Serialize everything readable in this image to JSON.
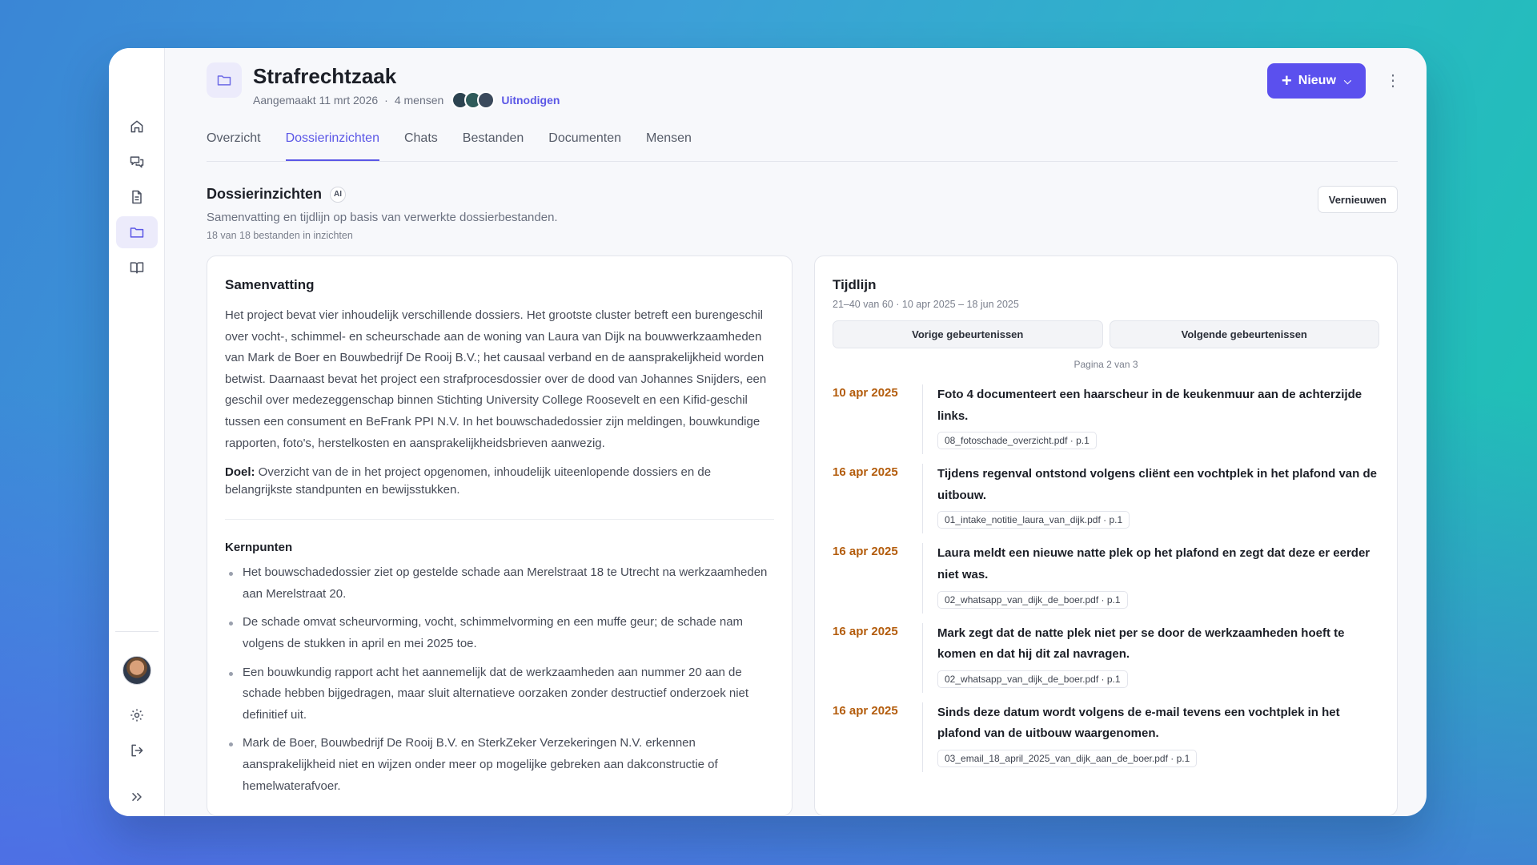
{
  "project": {
    "title": "Strafrechtzaak",
    "created": "Aangemaakt 11 mrt 2026",
    "separator": "·",
    "people_count": "4 mensen",
    "invite_label": "Uitnodigen"
  },
  "header": {
    "new_button": "Nieuw"
  },
  "tabs": [
    {
      "label": "Overzicht"
    },
    {
      "label": "Dossierinzichten"
    },
    {
      "label": "Chats"
    },
    {
      "label": "Bestanden"
    },
    {
      "label": "Documenten"
    },
    {
      "label": "Mensen"
    }
  ],
  "section": {
    "title": "Dossierinzichten",
    "ai_badge": "AI",
    "subtitle": "Samenvatting en tijdlijn op basis van verwerkte dossierbestanden.",
    "note": "18 van 18 bestanden in inzichten",
    "refresh_button": "Vernieuwen"
  },
  "summary": {
    "title": "Samenvatting",
    "text": "Het project bevat vier inhoudelijk verschillende dossiers. Het grootste cluster betreft een burengeschil over vocht-, schimmel- en scheurschade aan de woning van Laura van Dijk na bouwwerkzaamheden van Mark de Boer en Bouwbedrijf De Rooij B.V.; het causaal verband en de aansprakelijkheid worden betwist. Daarnaast bevat het project een strafprocesdossier over de dood van Johannes Snijders, een geschil over medezeggenschap binnen Stichting University College Roosevelt en een Kifid-geschil tussen een consument en BeFrank PPI N.V. In het bouwschadedossier zijn meldingen, bouwkundige rapporten, foto's, herstelkosten en aansprakelijkheidsbrieven aanwezig.",
    "goal_label": "Doel:",
    "goal_text": " Overzicht van de in het project opgenomen, inhoudelijk uiteenlopende dossiers en de belangrijkste standpunten en bewijsstukken.",
    "key_points_title": "Kernpunten",
    "key_points": [
      "Het bouwschadedossier ziet op gestelde schade aan Merelstraat 18 te Utrecht na werkzaamheden aan Merelstraat 20.",
      "De schade omvat scheurvorming, vocht, schimmelvorming en een muffe geur; de schade nam volgens de stukken in april en mei 2025 toe.",
      "Een bouwkundig rapport acht het aannemelijk dat de werkzaamheden aan nummer 20 aan de schade hebben bijgedragen, maar sluit alternatieve oorzaken zonder destructief onderzoek niet definitief uit.",
      "Mark de Boer, Bouwbedrijf De Rooij B.V. en SterkZeker Verzekeringen N.V. erkennen aansprakelijkheid niet en wijzen onder meer op mogelijke gebreken aan dakconstructie of hemelwaterafvoer."
    ]
  },
  "timeline": {
    "title": "Tijdlijn",
    "meta": "21–40 van 60 · 10 apr 2025 – 18 jun 2025",
    "prev_button": "Vorige gebeurtenissen",
    "next_button": "Volgende gebeurtenissen",
    "page": "Pagina 2 van 3",
    "events": [
      {
        "date": "10 apr 2025",
        "text": "Foto 4 documenteert een haarscheur in de keukenmuur aan de achterzijde links.",
        "source": "08_fotoschade_overzicht.pdf · p.1"
      },
      {
        "date": "16 apr 2025",
        "text": "Tijdens regenval ontstond volgens cliënt een vochtplek in het plafond van de uitbouw.",
        "source": "01_intake_notitie_laura_van_dijk.pdf · p.1"
      },
      {
        "date": "16 apr 2025",
        "text": "Laura meldt een nieuwe natte plek op het plafond en zegt dat deze er eerder niet was.",
        "source": "02_whatsapp_van_dijk_de_boer.pdf · p.1"
      },
      {
        "date": "16 apr 2025",
        "text": "Mark zegt dat de natte plek niet per se door de werkzaamheden hoeft te komen en dat hij dit zal navragen.",
        "source": "02_whatsapp_van_dijk_de_boer.pdf · p.1"
      },
      {
        "date": "16 apr 2025",
        "text": "Sinds deze datum wordt volgens de e-mail tevens een vochtplek in het plafond van de uitbouw waargenomen.",
        "source": "03_email_18_april_2025_van_dijk_aan_de_boer.pdf · p.1"
      }
    ]
  },
  "colors": {
    "accent": "#5b50ee",
    "date": "#b35c0c"
  }
}
